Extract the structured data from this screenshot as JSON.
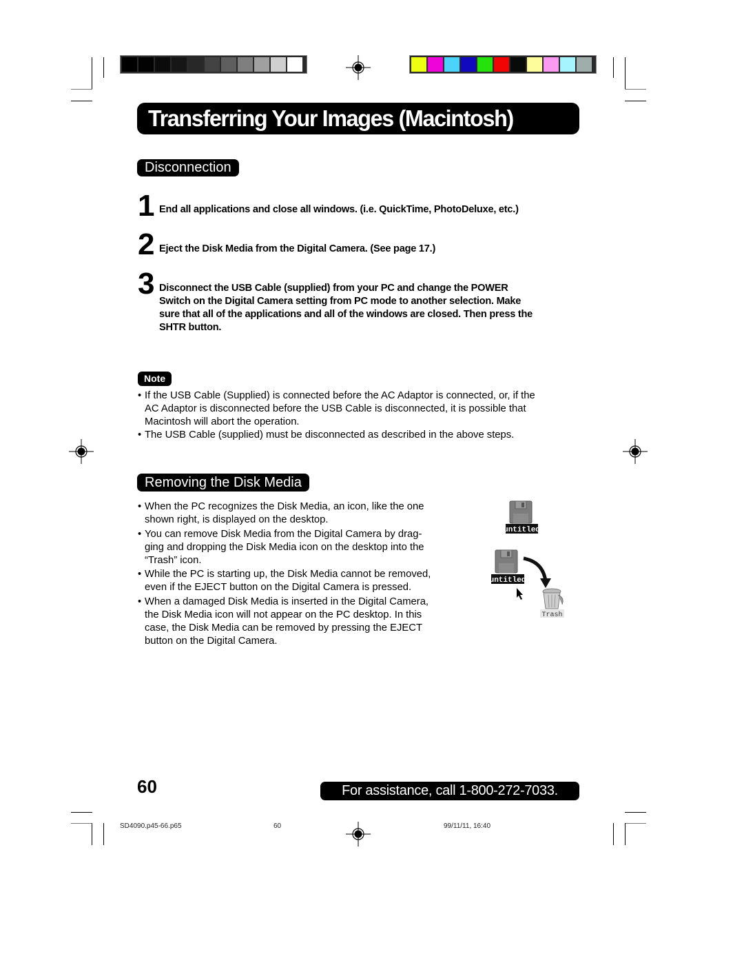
{
  "print_marks": {
    "gray_swatches": [
      "#000000",
      "#020202",
      "#0b0b0b",
      "#161616",
      "#282828",
      "#434343",
      "#5f5f5f",
      "#7f7f7f",
      "#a0a0a0",
      "#cfcfcf",
      "#ffffff"
    ],
    "color_swatches": [
      "#eefe13",
      "#ee04d9",
      "#4cd3fb",
      "#1109bd",
      "#25e20a",
      "#f20404",
      "#090b0a",
      "#fdfd9b",
      "#fb9af1",
      "#a6f4fd",
      "#a0aeab"
    ]
  },
  "page": {
    "title": "Transferring Your Images (Macintosh)",
    "sections": [
      {
        "heading": "Disconnection",
        "steps": [
          {
            "number": "1",
            "text": "End all applications and close all windows. (i.e. QuickTime, PhotoDeluxe, etc.)"
          },
          {
            "number": "2",
            "text": "Eject the Disk Media from the Digital Camera.  (See page 17.)"
          },
          {
            "number": "3",
            "lines": [
              "Disconnect  the USB Cable (supplied) from your PC and change the POWER",
              "Switch on the Digital Camera setting  from PC mode to another selection. Make",
              "sure that all of the applications and all of the windows are closed. Then press the",
              "SHTR button."
            ]
          }
        ],
        "note": {
          "label": "Note",
          "bullets": [
            {
              "lines": [
                "If the USB Cable (Supplied) is connected before the AC Adaptor is connected, or, if the",
                "AC Adaptor is disconnected before the USB Cable is disconnected, it is possible that",
                "Macintosh will abort the operation."
              ]
            },
            {
              "lines": [
                "The USB Cable (supplied) must be disconnected as described in the above steps."
              ]
            }
          ]
        }
      },
      {
        "heading": "Removing the Disk Media",
        "bullets": [
          {
            "lines": [
              "When the PC recognizes the Disk Media, an icon, like the one",
              "shown right, is displayed on the desktop."
            ]
          },
          {
            "lines": [
              "You can remove Disk Media from the Digital Camera by drag-",
              "ging and dropping the Disk Media icon on the desktop into the",
              "“Trash” icon."
            ]
          },
          {
            "lines": [
              "While the PC is starting up, the Disk Media cannot be removed,",
              "even if the EJECT button on the Digital Camera is pressed."
            ]
          },
          {
            "lines": [
              "When a damaged Disk Media is inserted in the Digital Camera,",
              "the Disk Media icon will not appear on the PC desktop. In this",
              "case, the Disk Media can be removed by pressing the EJECT",
              "button on the Digital Camera."
            ]
          }
        ],
        "illustration": {
          "disk_label_1": "untitled",
          "disk_label_2": "untitled",
          "trash_label": "Trash"
        }
      }
    ],
    "page_number": "60",
    "assistance": "For assistance, call 1-800-272-7033.",
    "bullet_char": "•"
  },
  "footer": {
    "filename": "SD4090.p45-66.p65",
    "page": "60",
    "timestamp": "99/11/11, 16:40"
  }
}
